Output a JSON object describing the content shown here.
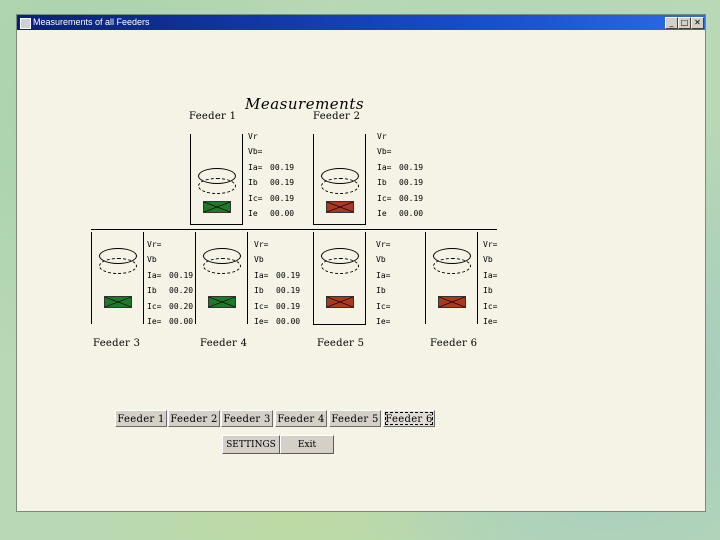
{
  "window": {
    "title": "Measurements of all Feeders",
    "controls": {
      "minimize": "_",
      "maximize": "□",
      "close": "✕"
    }
  },
  "heading": "Measurements",
  "feeders": [
    {
      "name": "Feeder 1",
      "status": "green",
      "labels": [
        "Vr",
        "Vb=",
        "Ia=",
        "Ib",
        "Ic=",
        "Ie"
      ],
      "values": [
        "",
        "",
        "00.19",
        "00.19",
        "00.19",
        "00.00"
      ]
    },
    {
      "name": "Feeder 2",
      "status": "red",
      "labels": [
        "Vr",
        "Vb=",
        "Ia=",
        "Ib",
        "Ic=",
        "Ie"
      ],
      "values": [
        "",
        "",
        "00.19",
        "00.19",
        "00.19",
        "00.00"
      ]
    },
    {
      "name": "Feeder 3",
      "status": "green",
      "labels": [
        "Vr=",
        "Vb",
        "Ia=",
        "Ib",
        "Ic=",
        "Ie="
      ],
      "values": [
        "",
        "",
        "00.19",
        "00.20",
        "00.20",
        "00.00"
      ]
    },
    {
      "name": "Feeder 4",
      "status": "green",
      "labels": [
        "Vr=",
        "Vb",
        "Ia=",
        "Ib",
        "Ic=",
        "Ie="
      ],
      "values": [
        "",
        "",
        "00.19",
        "00.19",
        "00.19",
        "00.00"
      ]
    },
    {
      "name": "Feeder 5",
      "status": "red",
      "labels": [
        "Vr=",
        "Vb",
        "Ia=",
        "Ib",
        "Ic=",
        "Ie="
      ],
      "values": [
        "",
        "",
        "",
        "",
        "",
        ""
      ]
    },
    {
      "name": "Feeder 6",
      "status": "red",
      "labels": [
        "Vr=",
        "Vb",
        "Ia=",
        "Ib",
        "Ic=",
        "Ie="
      ],
      "values": [
        "",
        "",
        "",
        "",
        "",
        ""
      ]
    }
  ],
  "tabs": [
    "Feeder 1",
    "Feeder 2",
    "Feeder 3",
    "Feeder 4",
    "Feeder 5",
    "Feeder 6"
  ],
  "active_tab": "Feeder 6",
  "buttons": {
    "settings": "SETTINGS",
    "exit": "Exit"
  },
  "colors": {
    "status_green": "#1e7a2a",
    "status_red": "#a83a22",
    "titlebar": "#0a1f7a"
  }
}
